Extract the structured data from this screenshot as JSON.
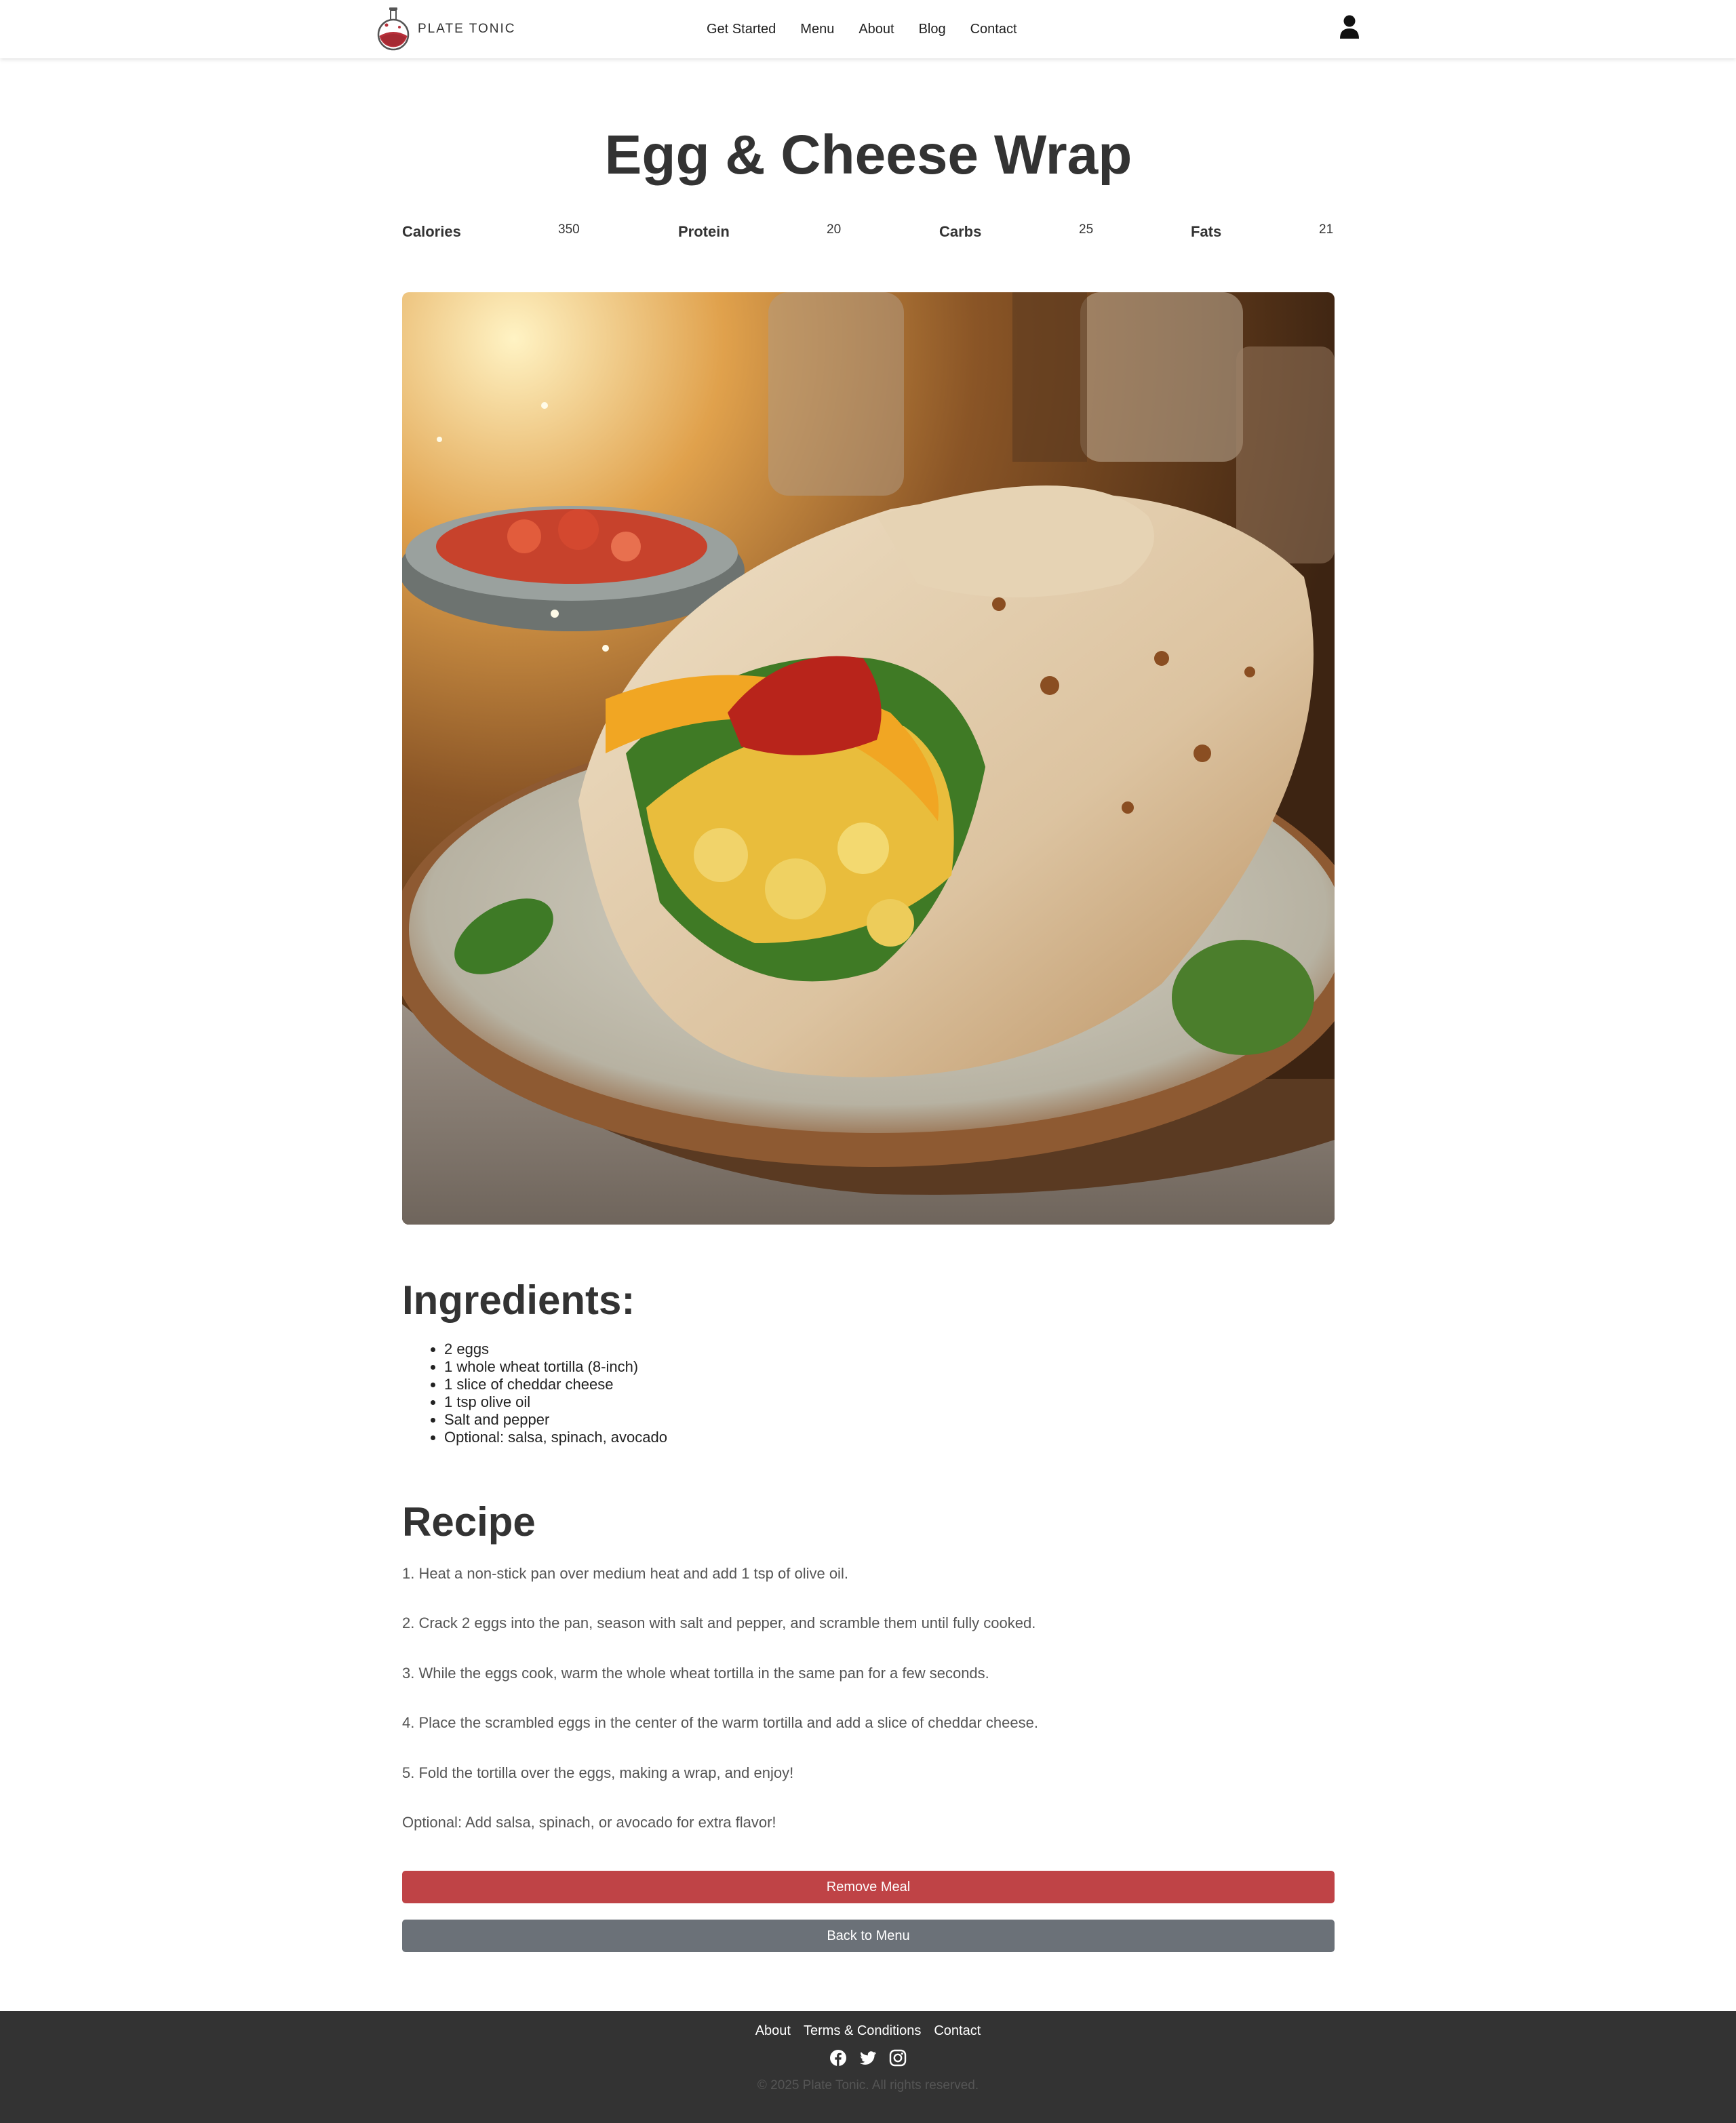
{
  "brand": {
    "name": "PLATE TONIC"
  },
  "nav": {
    "links": [
      "Get Started",
      "Menu",
      "About",
      "Blog",
      "Contact"
    ]
  },
  "meal": {
    "title": "Egg & Cheese Wrap",
    "macros": [
      {
        "label": "Calories",
        "value": "350"
      },
      {
        "label": "Protein",
        "value": "20"
      },
      {
        "label": "Carbs",
        "value": "25"
      },
      {
        "label": "Fats",
        "value": "21"
      }
    ]
  },
  "ingredients": {
    "heading": "Ingredients:",
    "items": [
      "2 eggs",
      "1 whole wheat tortilla (8-inch)",
      "1 slice of cheddar cheese",
      "1 tsp olive oil",
      "Salt and pepper",
      "Optional: salsa, spinach, avocado"
    ]
  },
  "recipe": {
    "heading": "Recipe",
    "steps": [
      "1. Heat a non-stick pan over medium heat and add 1 tsp of olive oil.",
      "2. Crack 2 eggs into the pan, season with salt and pepper, and scramble them until fully cooked.",
      "3. While the eggs cook, warm the whole wheat tortilla in the same pan for a few seconds.",
      "4. Place the scrambled eggs in the center of the warm tortilla and add a slice of cheddar cheese.",
      "5. Fold the tortilla over the eggs, making a wrap, and enjoy!",
      "Optional: Add salsa, spinach, or avocado for extra flavor!"
    ]
  },
  "actions": {
    "remove_label": "Remove Meal",
    "back_label": "Back to Menu"
  },
  "footer": {
    "links": [
      "About",
      "Terms & Conditions",
      "Contact"
    ],
    "social": [
      "facebook-icon",
      "twitter-icon",
      "instagram-icon"
    ],
    "copyright": "© 2025 Plate Tonic. All rights reserved."
  },
  "colors": {
    "remove_button": "#bf4346",
    "back_button": "#6b7178",
    "footer_bg": "#333333",
    "text": "#333333"
  }
}
